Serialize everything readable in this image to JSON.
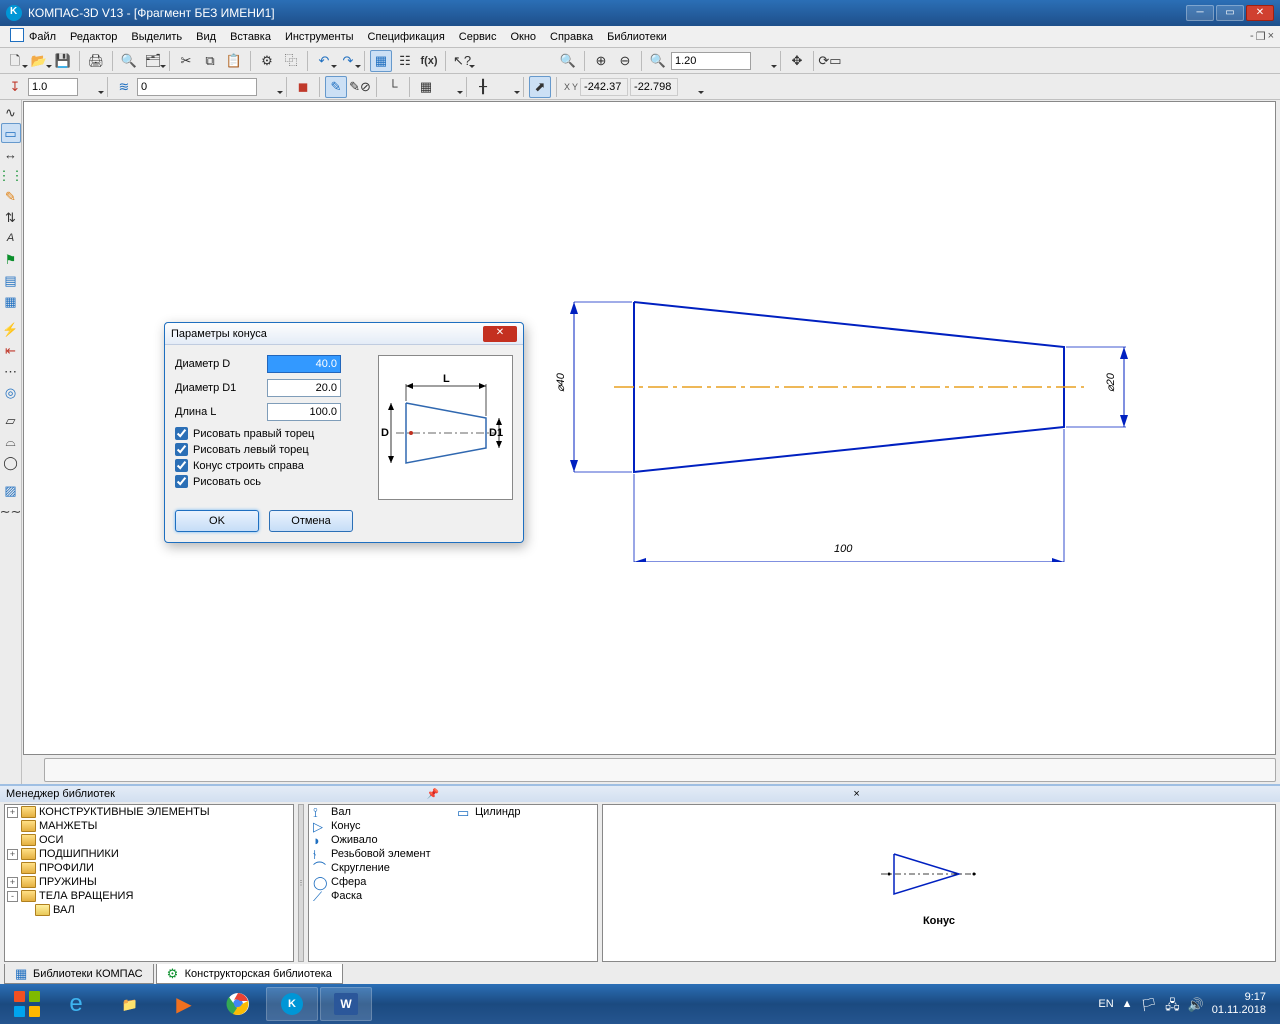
{
  "window": {
    "title": "КОМПАС-3D V13 - [Фрагмент БЕЗ ИМЕНИ1]"
  },
  "menu": {
    "items": [
      "Файл",
      "Редактор",
      "Выделить",
      "Вид",
      "Вставка",
      "Инструменты",
      "Спецификация",
      "Сервис",
      "Окно",
      "Справка",
      "Библиотеки"
    ]
  },
  "toolbar": {
    "zoom_value": "1.20",
    "x": "-242.37",
    "y": "-22.798",
    "scale": "1.0",
    "layer": "0"
  },
  "dialog": {
    "title": "Параметры конуса",
    "diam_d_label": "Диаметр D",
    "diam_d_value": "40.0",
    "diam_d1_label": "Диаметр D1",
    "diam_d1_value": "20.0",
    "len_l_label": "Длина L",
    "len_l_value": "100.0",
    "ck_right": "Рисовать правый торец",
    "ck_left": "Рисовать левый торец",
    "ck_cone": "Конус строить справа",
    "ck_axis": "Рисовать ось",
    "ok": "OK",
    "cancel": "Отмена",
    "prev_L": "L",
    "prev_D": "D",
    "prev_D1": "D1"
  },
  "drawing": {
    "dim_d": "⌀40",
    "dim_d1": "⌀20",
    "dim_l": "100"
  },
  "libmgr": {
    "title": "Менеджер библиотек",
    "tree": [
      {
        "expand": "+",
        "name": "КОНСТРУКТИВНЫЕ ЭЛЕМЕНТЫ"
      },
      {
        "expand": "",
        "name": "МАНЖЕТЫ"
      },
      {
        "expand": "",
        "name": "ОСИ"
      },
      {
        "expand": "+",
        "name": "ПОДШИПНИКИ"
      },
      {
        "expand": "",
        "name": "ПРОФИЛИ"
      },
      {
        "expand": "+",
        "name": "ПРУЖИНЫ"
      },
      {
        "expand": "-",
        "name": "ТЕЛА ВРАЩЕНИЯ"
      }
    ],
    "tree_child": "ВАЛ",
    "list": [
      "Вал",
      "Конус",
      "Оживало",
      "Резьбовой элемент",
      "Скругление",
      "Сфера",
      "Фаска",
      "Цилиндр"
    ],
    "preview_caption": "Конус",
    "tab_libs": "Библиотеки КОМПАС",
    "tab_constr": "Конструкторская библиотека"
  },
  "tray": {
    "lang": "EN",
    "time": "9:17",
    "date": "01.11.2018",
    "arrow": "▲"
  }
}
